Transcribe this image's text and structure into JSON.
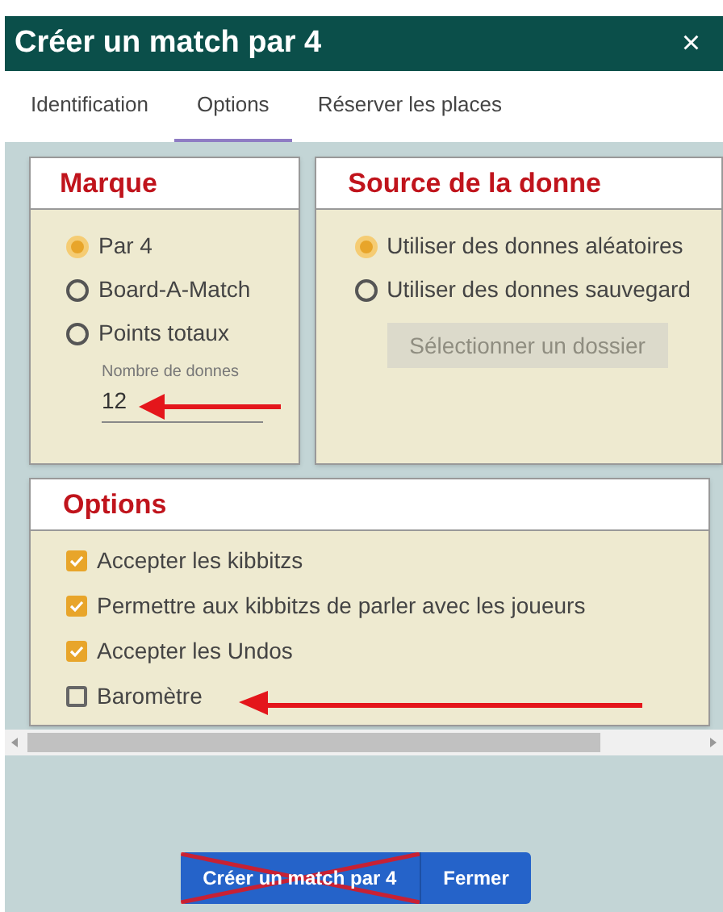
{
  "window": {
    "title": "Créer un match par 4",
    "close": "×"
  },
  "tabs": [
    {
      "label": "Identification",
      "selected": false
    },
    {
      "label": "Options",
      "selected": true
    },
    {
      "label": "Réserver les places",
      "selected": false
    }
  ],
  "scoring": {
    "title": "Marque",
    "options": [
      {
        "label": "Par 4",
        "selected": true
      },
      {
        "label": "Board-A-Match",
        "selected": false
      },
      {
        "label": "Points totaux",
        "selected": false
      }
    ],
    "boards_field": {
      "label": "Nombre de donnes",
      "value": "12"
    }
  },
  "deal_source": {
    "title": "Source de la donne",
    "options": [
      {
        "label": "Utiliser des donnes aléatoires",
        "selected": true
      },
      {
        "label": "Utiliser des donnes sauvegard",
        "selected": false
      }
    ],
    "folder_button": {
      "label": "Sélectionner un dossier",
      "disabled": true
    }
  },
  "options": {
    "title": "Options",
    "items": [
      {
        "label": "Accepter les kibbitzs",
        "checked": true
      },
      {
        "label": "Permettre aux kibbitzs de parler avec les joueurs",
        "checked": true
      },
      {
        "label": "Accepter les Undos",
        "checked": true
      },
      {
        "label": "Baromètre",
        "checked": false
      }
    ]
  },
  "buttons": [
    {
      "label": "Créer un match par 4",
      "crossed_out": true
    },
    {
      "label": "Fermer",
      "crossed_out": false
    }
  ]
}
